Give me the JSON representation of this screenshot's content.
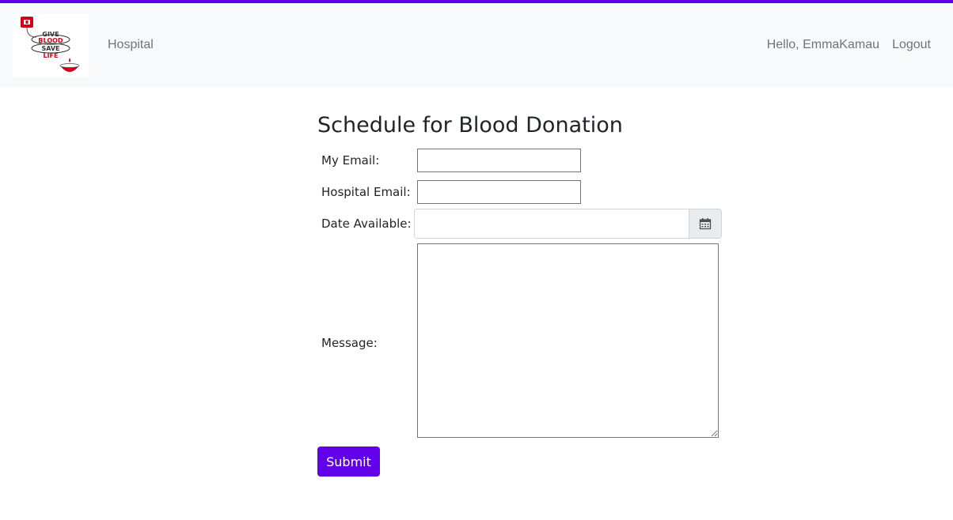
{
  "brand": {
    "logo_text": [
      "GIVE",
      "BLOOD",
      "SAVE",
      "LIFE"
    ],
    "accent_color": "#6200ea"
  },
  "nav": {
    "hospital_link": "Hospital",
    "greeting": "Hello, EmmaKamau",
    "logout": "Logout"
  },
  "form": {
    "title": "Schedule for Blood Donation",
    "my_email_label": "My Email:",
    "my_email_value": "",
    "hospital_email_label": "Hospital Email:",
    "hospital_email_value": "",
    "date_label": "Date Available:",
    "date_value": "",
    "date_icon": "calendar-icon",
    "message_label": "Message:",
    "message_value": "",
    "submit_label": "Submit"
  }
}
